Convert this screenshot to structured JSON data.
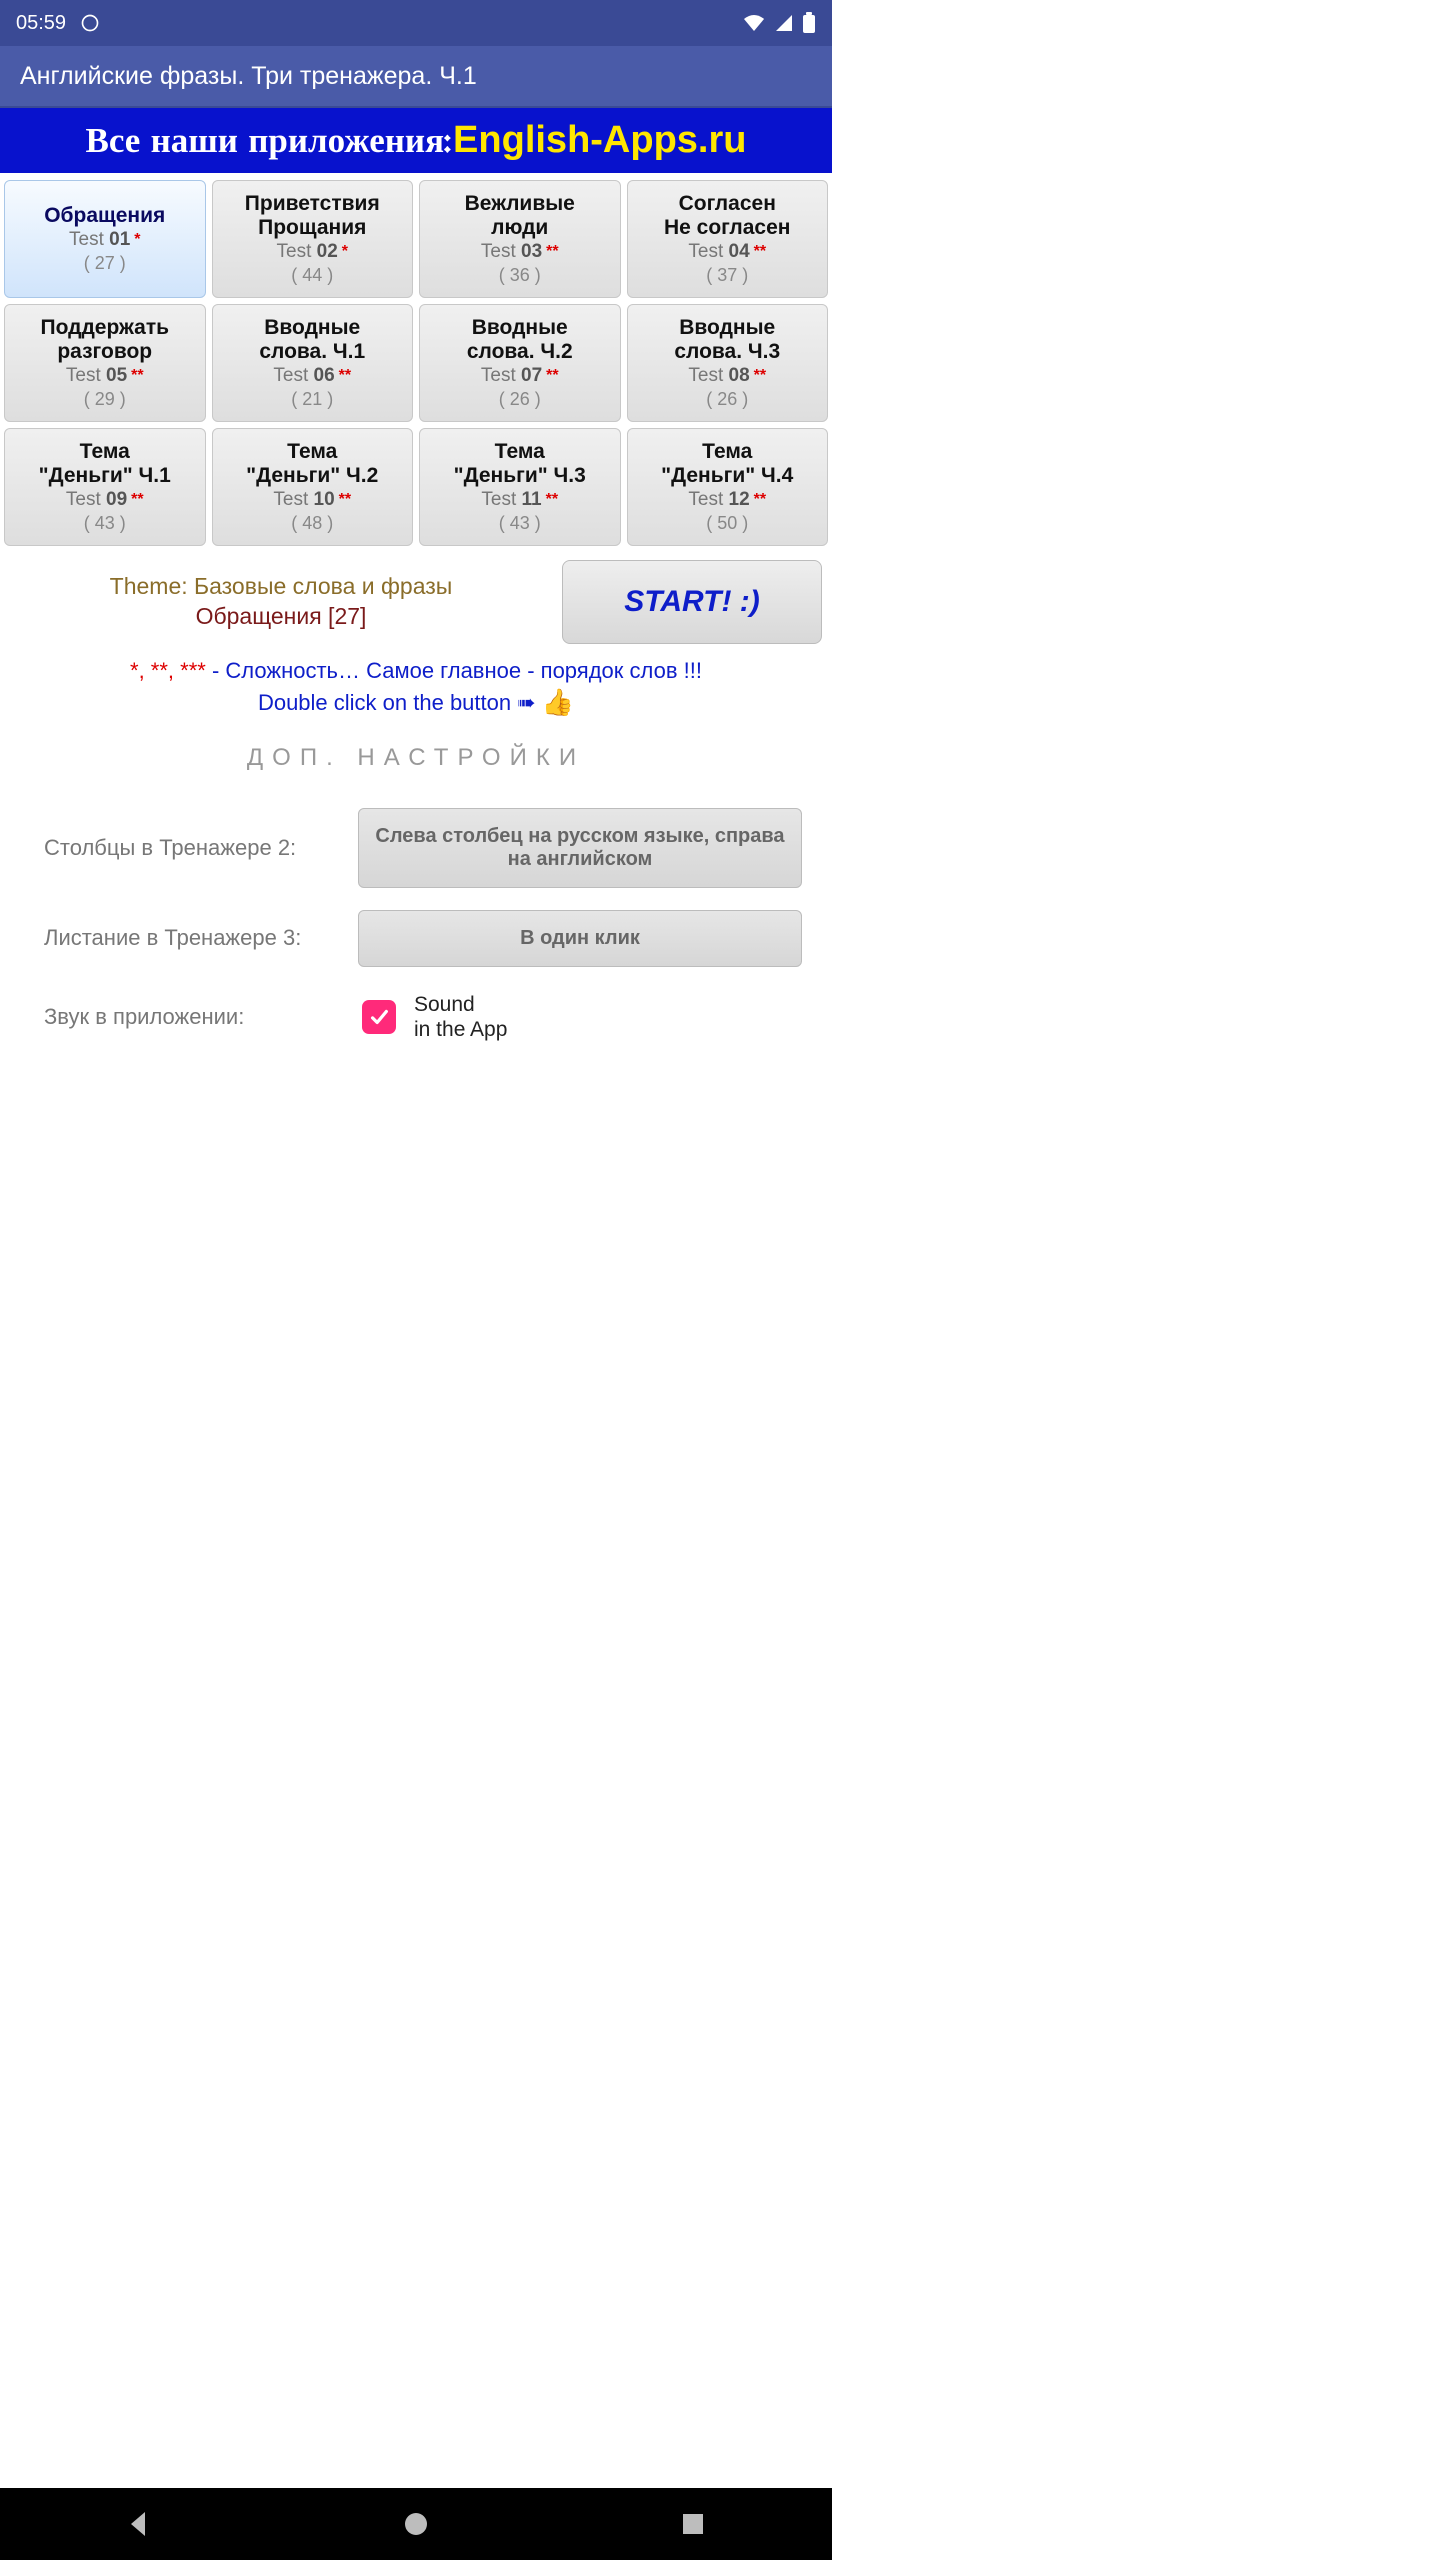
{
  "status": {
    "time": "05:59"
  },
  "title": "Английские фразы. Три тренажера. Ч.1",
  "banner": {
    "left": "Все наши приложения:",
    "right": "English-Apps.ru"
  },
  "tiles": [
    {
      "title": "Обращения",
      "num": "01",
      "stars": "*",
      "count": "( 27 )",
      "active": true
    },
    {
      "title": "Приветствия\nПрощания",
      "num": "02",
      "stars": "*",
      "count": "( 44 )",
      "active": false
    },
    {
      "title": "Вежливые\nлюди",
      "num": "03",
      "stars": "**",
      "count": "( 36 )",
      "active": false
    },
    {
      "title": "Согласен\nНе согласен",
      "num": "04",
      "stars": "**",
      "count": "( 37 )",
      "active": false
    },
    {
      "title": "Поддержать\nразговор",
      "num": "05",
      "stars": "**",
      "count": "( 29 )",
      "active": false
    },
    {
      "title": "Вводные\nслова. Ч.1",
      "num": "06",
      "stars": "**",
      "count": "( 21 )",
      "active": false
    },
    {
      "title": "Вводные\nслова. Ч.2",
      "num": "07",
      "stars": "**",
      "count": "( 26 )",
      "active": false
    },
    {
      "title": "Вводные\nслова. Ч.3",
      "num": "08",
      "stars": "**",
      "count": "( 26 )",
      "active": false
    },
    {
      "title": "Тема\n\"Деньги\" Ч.1",
      "num": "09",
      "stars": "**",
      "count": "( 43 )",
      "active": false
    },
    {
      "title": "Тема\n\"Деньги\" Ч.2",
      "num": "10",
      "stars": "**",
      "count": "( 48 )",
      "active": false
    },
    {
      "title": "Тема\n\"Деньги\" Ч.3",
      "num": "11",
      "stars": "**",
      "count": "( 43 )",
      "active": false
    },
    {
      "title": "Тема\n\"Деньги\" Ч.4",
      "num": "12",
      "stars": "**",
      "count": "( 50 )",
      "active": false
    }
  ],
  "theme": {
    "line1": "Theme: Базовые слова и фразы",
    "line2": "Обращения [27]"
  },
  "start_label": "START! :)",
  "info": {
    "stars": "*, **, ***",
    "text1_rest": " - Сложность… Самое главное - порядок слов !!!",
    "text2": "Double click on the button ➠"
  },
  "settings_title": "ДОП. НАСТРОЙКИ",
  "settings": {
    "cols_label": "Столбцы в Тренажере 2:",
    "cols_value": "Слева столбец на русском языке, справа на английском",
    "paging_label": "Листание в Тренажере 3:",
    "paging_value": "В один клик",
    "sound_label": "Звук в приложении:",
    "sound_value": "Sound\nin the App"
  },
  "test_word": "Test"
}
